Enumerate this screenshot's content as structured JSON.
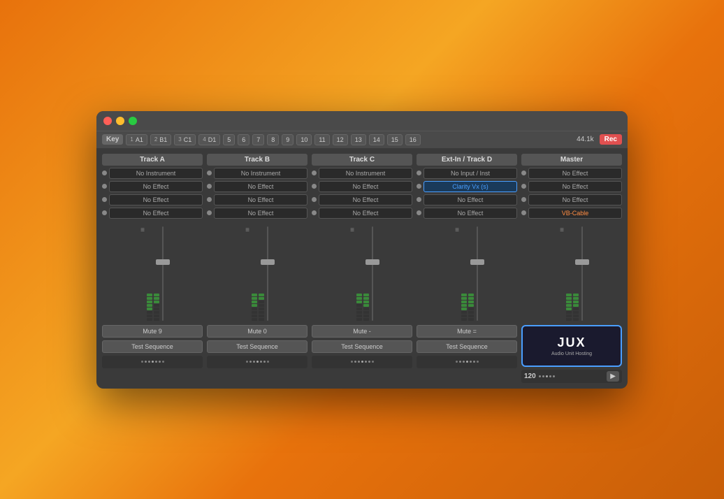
{
  "window": {
    "title": "JUX Audio Unit Hosting"
  },
  "toolbar": {
    "key_label": "Key",
    "channels": [
      {
        "num": "1",
        "label": "A1"
      },
      {
        "num": "2",
        "label": "B1"
      },
      {
        "num": "3",
        "label": "C1"
      },
      {
        "num": "4",
        "label": "D1"
      },
      {
        "num": "",
        "label": "5"
      },
      {
        "num": "",
        "label": "6"
      },
      {
        "num": "",
        "label": "7"
      },
      {
        "num": "",
        "label": "8"
      },
      {
        "num": "",
        "label": "9"
      },
      {
        "num": "",
        "label": "10"
      },
      {
        "num": "",
        "label": "11"
      },
      {
        "num": "",
        "label": "12"
      },
      {
        "num": "",
        "label": "13"
      },
      {
        "num": "",
        "label": "14"
      },
      {
        "num": "",
        "label": "15"
      },
      {
        "num": "",
        "label": "16"
      }
    ],
    "sample_rate": "44.1k",
    "rec_label": "Rec"
  },
  "tracks": [
    {
      "id": "track-a",
      "header": "Track A",
      "instrument": "No Instrument",
      "effects": [
        "No Effect",
        "No Effect",
        "No Effect"
      ],
      "mute": "Mute  9",
      "seq": "Test Sequence"
    },
    {
      "id": "track-b",
      "header": "Track B",
      "instrument": "No Instrument",
      "effects": [
        "No Effect",
        "No Effect",
        "No Effect"
      ],
      "mute": "Mute  0",
      "seq": "Test Sequence"
    },
    {
      "id": "track-c",
      "header": "Track C",
      "instrument": "No Instrument",
      "effects": [
        "No Effect",
        "No Effect",
        "No Effect"
      ],
      "mute": "Mute  -",
      "seq": "Test Sequence"
    },
    {
      "id": "track-d",
      "header": "Ext-In / Track D",
      "instrument": "No Input / Inst",
      "effects": [
        "Clarity Vx (s)",
        "No Effect",
        "No Effect"
      ],
      "effect_styles": [
        "blue",
        "normal",
        "normal"
      ],
      "mute": "Mute  =",
      "seq": "Test Sequence"
    }
  ],
  "master": {
    "header": "Master",
    "instrument": "No Effect",
    "effects": [
      "No Effect",
      "No Effect",
      "VB-Cable"
    ],
    "effect_styles": [
      "normal",
      "normal",
      "orange"
    ],
    "logo_text": "JUX",
    "logo_sub": "Audio Unit Hosting",
    "bpm": "120"
  },
  "icons": {
    "hamburger": "≡",
    "play": "▶"
  }
}
